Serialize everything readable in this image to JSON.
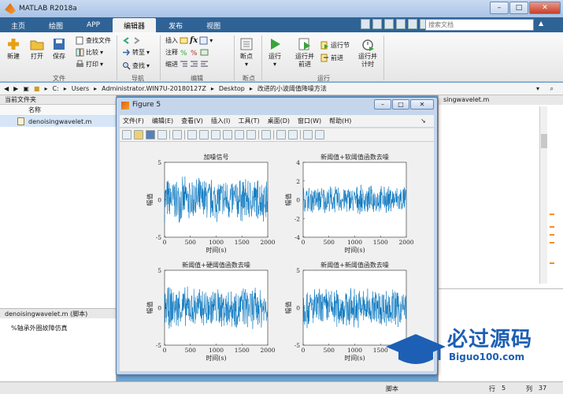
{
  "window": {
    "title": "MATLAB R2018a",
    "min": "–",
    "max": "□",
    "close": "✕"
  },
  "tabs": [
    {
      "label": "主页"
    },
    {
      "label": "绘图"
    },
    {
      "label": "APP"
    },
    {
      "label": "编辑器"
    },
    {
      "label": "发布"
    },
    {
      "label": "视图"
    }
  ],
  "active_tab": "编辑器",
  "search": {
    "placeholder": "搜索文档"
  },
  "ribbon": {
    "file": {
      "new": "新建",
      "open": "打开",
      "save": "保存",
      "find_files": "查找文件",
      "compare": "比较",
      "print": "打印",
      "group": "文件"
    },
    "nav": {
      "goto": "转至",
      "find": "查找",
      "group": "导航"
    },
    "edit": {
      "insert": "插入",
      "comment": "注释",
      "indent": "缩进",
      "fx": "fx",
      "group": "编辑"
    },
    "breakpoints": {
      "label": "断点",
      "group": "断点"
    },
    "run": {
      "run": "运行",
      "run_advance": "运行并\n前进",
      "run_section": "运行节",
      "advance": "前进",
      "run_time": "运行并\n计时",
      "group": "运行"
    }
  },
  "address": {
    "parts": [
      "C:",
      "Users",
      "Administrator.WIN7U-20180127Z",
      "Desktop",
      "改进的小波阈值降噪方法"
    ]
  },
  "left_panel": {
    "title": "当前文件夹",
    "column": "名称",
    "file": "denoisingwavelet.m",
    "detail_title": "denoisingwavelet.m  (脚本)",
    "detail_text": "%轴承外圈故障仿真"
  },
  "right_panel": {
    "title": "singwavelet.m"
  },
  "status": {
    "script": "脚本",
    "row_label": "行",
    "row": "5",
    "col_label": "列",
    "col": "37"
  },
  "figure": {
    "title": "Figure 5",
    "menu": [
      "文件(F)",
      "编辑(E)",
      "查看(V)",
      "插入(I)",
      "工具(T)",
      "桌面(D)",
      "窗口(W)",
      "帮助(H)"
    ]
  },
  "chart_data": [
    {
      "type": "line",
      "title": "加噪信号",
      "xlabel": "时间(s)",
      "ylabel": "幅值",
      "xlim": [
        0,
        2000
      ],
      "ylim": [
        -5,
        5
      ],
      "xticks": [
        0,
        500,
        1000,
        1500,
        2000
      ],
      "yticks": [
        -5,
        0,
        5
      ],
      "amplitude": 3.2
    },
    {
      "type": "line",
      "title": "新阈值+软阈值函数去噪",
      "xlabel": "时间(s)",
      "ylabel": "幅值",
      "xlim": [
        0,
        2000
      ],
      "ylim": [
        -4,
        4
      ],
      "xticks": [
        0,
        500,
        1000,
        1500,
        2000
      ],
      "yticks": [
        -4,
        -2,
        0,
        2,
        4
      ],
      "amplitude": 1.6
    },
    {
      "type": "line",
      "title": "新阈值+硬阈值函数去噪",
      "xlabel": "时间(s)",
      "ylabel": "幅值",
      "xlim": [
        0,
        2000
      ],
      "ylim": [
        -5,
        5
      ],
      "xticks": [
        0,
        500,
        1000,
        1500,
        2000
      ],
      "yticks": [
        -5,
        0,
        5
      ],
      "amplitude": 3.0
    },
    {
      "type": "line",
      "title": "新阈值+新阈值函数去噪",
      "xlabel": "时间(s)",
      "ylabel": "幅值",
      "xlim": [
        0,
        2000
      ],
      "ylim": [
        -5,
        5
      ],
      "xticks": [
        0,
        500,
        1000,
        1500,
        2000
      ],
      "yticks": [
        -5,
        0,
        5
      ],
      "amplitude": 2.9
    }
  ],
  "colors": {
    "plot_line": "#0072bd",
    "tab_bar": "#2f6396",
    "watermark": "#1d5fb4"
  },
  "watermark": {
    "cn": "必过源码",
    "en": "Biguo100.com"
  }
}
